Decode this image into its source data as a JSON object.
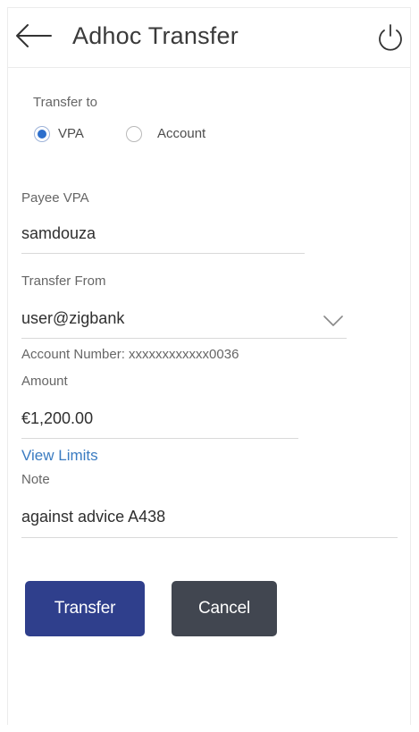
{
  "header": {
    "title": "Adhoc Transfer",
    "back_icon": "arrow-left-icon",
    "power_icon": "power-icon"
  },
  "transfer_to": {
    "label": "Transfer to",
    "options": [
      {
        "label": "VPA",
        "selected": true
      },
      {
        "label": "Account",
        "selected": false
      }
    ]
  },
  "payee_vpa": {
    "label": "Payee VPA",
    "value": "samdouza"
  },
  "transfer_from": {
    "label": "Transfer From",
    "value": "user@zigbank",
    "account_number_text": "Account Number: xxxxxxxxxxxx0036"
  },
  "amount": {
    "label": "Amount",
    "value": "€1,200.00",
    "view_limits": "View Limits"
  },
  "note": {
    "label": "Note",
    "value": "against advice A438"
  },
  "actions": {
    "transfer_label": "Transfer",
    "cancel_label": "Cancel"
  },
  "colors": {
    "primary_button": "#2f3f8c",
    "secondary_button": "#414650",
    "link": "#3a7bc1",
    "radio_selected": "#2d6fcc"
  }
}
